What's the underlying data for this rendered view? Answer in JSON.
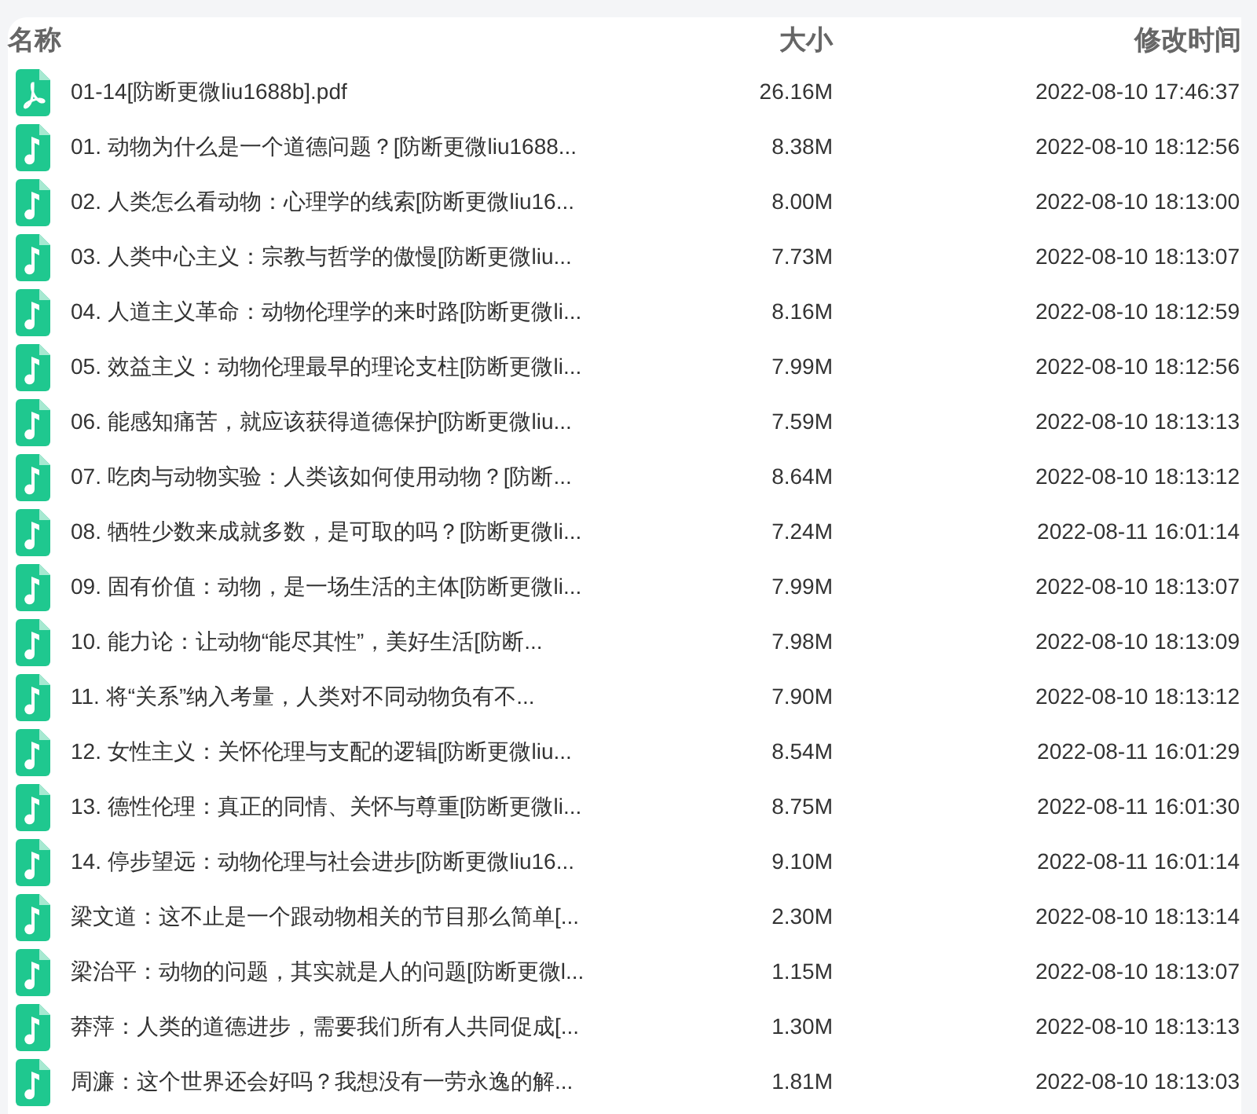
{
  "columns": [
    {
      "label": "名称"
    },
    {
      "label": "大小"
    },
    {
      "label": "修改时间"
    }
  ],
  "files": [
    {
      "kind": "pdf",
      "name": "01-14[防断更微liu1688b].pdf",
      "size": "26.16M",
      "modified": "2022-08-10 17:46:37"
    },
    {
      "kind": "audio",
      "name": "01. 动物为什么是一个道德问题？[防断更微liu1688...",
      "size": "8.38M",
      "modified": "2022-08-10 18:12:56"
    },
    {
      "kind": "audio",
      "name": "02. 人类怎么看动物：心理学的线索[防断更微liu16...",
      "size": "8.00M",
      "modified": "2022-08-10 18:13:00"
    },
    {
      "kind": "audio",
      "name": "03. 人类中心主义：宗教与哲学的傲慢[防断更微liu...",
      "size": "7.73M",
      "modified": "2022-08-10 18:13:07"
    },
    {
      "kind": "audio",
      "name": "04. 人道主义革命：动物伦理学的来时路[防断更微li...",
      "size": "8.16M",
      "modified": "2022-08-10 18:12:59"
    },
    {
      "kind": "audio",
      "name": "05. 效益主义：动物伦理最早的理论支柱[防断更微li...",
      "size": "7.99M",
      "modified": "2022-08-10 18:12:56"
    },
    {
      "kind": "audio",
      "name": "06. 能感知痛苦，就应该获得道德保护[防断更微liu...",
      "size": "7.59M",
      "modified": "2022-08-10 18:13:13"
    },
    {
      "kind": "audio",
      "name": "07. 吃肉与动物实验：人类该如何使用动物？[防断...",
      "size": "8.64M",
      "modified": "2022-08-10 18:13:12"
    },
    {
      "kind": "audio",
      "name": "08. 牺牲少数来成就多数，是可取的吗？[防断更微li...",
      "size": "7.24M",
      "modified": "2022-08-11 16:01:14"
    },
    {
      "kind": "audio",
      "name": "09. 固有价值：动物，是一场生活的主体[防断更微li...",
      "size": "7.99M",
      "modified": "2022-08-10 18:13:07"
    },
    {
      "kind": "audio",
      "name": "10. 能力论：让动物“能尽其性”，美好生活[防断...",
      "size": "7.98M",
      "modified": "2022-08-10 18:13:09"
    },
    {
      "kind": "audio",
      "name": "11. 将“关系”纳入考量，人类对不同动物负有不...",
      "size": "7.90M",
      "modified": "2022-08-10 18:13:12"
    },
    {
      "kind": "audio",
      "name": "12. 女性主义：关怀伦理与支配的逻辑[防断更微liu...",
      "size": "8.54M",
      "modified": "2022-08-11 16:01:29"
    },
    {
      "kind": "audio",
      "name": "13. 德性伦理：真正的同情、关怀与尊重[防断更微li...",
      "size": "8.75M",
      "modified": "2022-08-11 16:01:30"
    },
    {
      "kind": "audio",
      "name": "14. 停步望远：动物伦理与社会进步[防断更微liu16...",
      "size": "9.10M",
      "modified": "2022-08-11 16:01:14"
    },
    {
      "kind": "audio",
      "name": "梁文道：这不止是一个跟动物相关的节目那么简单[...",
      "size": "2.30M",
      "modified": "2022-08-10 18:13:14"
    },
    {
      "kind": "audio",
      "name": "梁治平：动物的问题，其实就是人的问题[防断更微l...",
      "size": "1.15M",
      "modified": "2022-08-10 18:13:07"
    },
    {
      "kind": "audio",
      "name": "莽萍：人类的道德进步，需要我们所有人共同促成[...",
      "size": "1.30M",
      "modified": "2022-08-10 18:13:13"
    },
    {
      "kind": "audio",
      "name": "周濂：这个世界还会好吗？我想没有一劳永逸的解...",
      "size": "1.81M",
      "modified": "2022-08-10 18:13:03"
    }
  ]
}
